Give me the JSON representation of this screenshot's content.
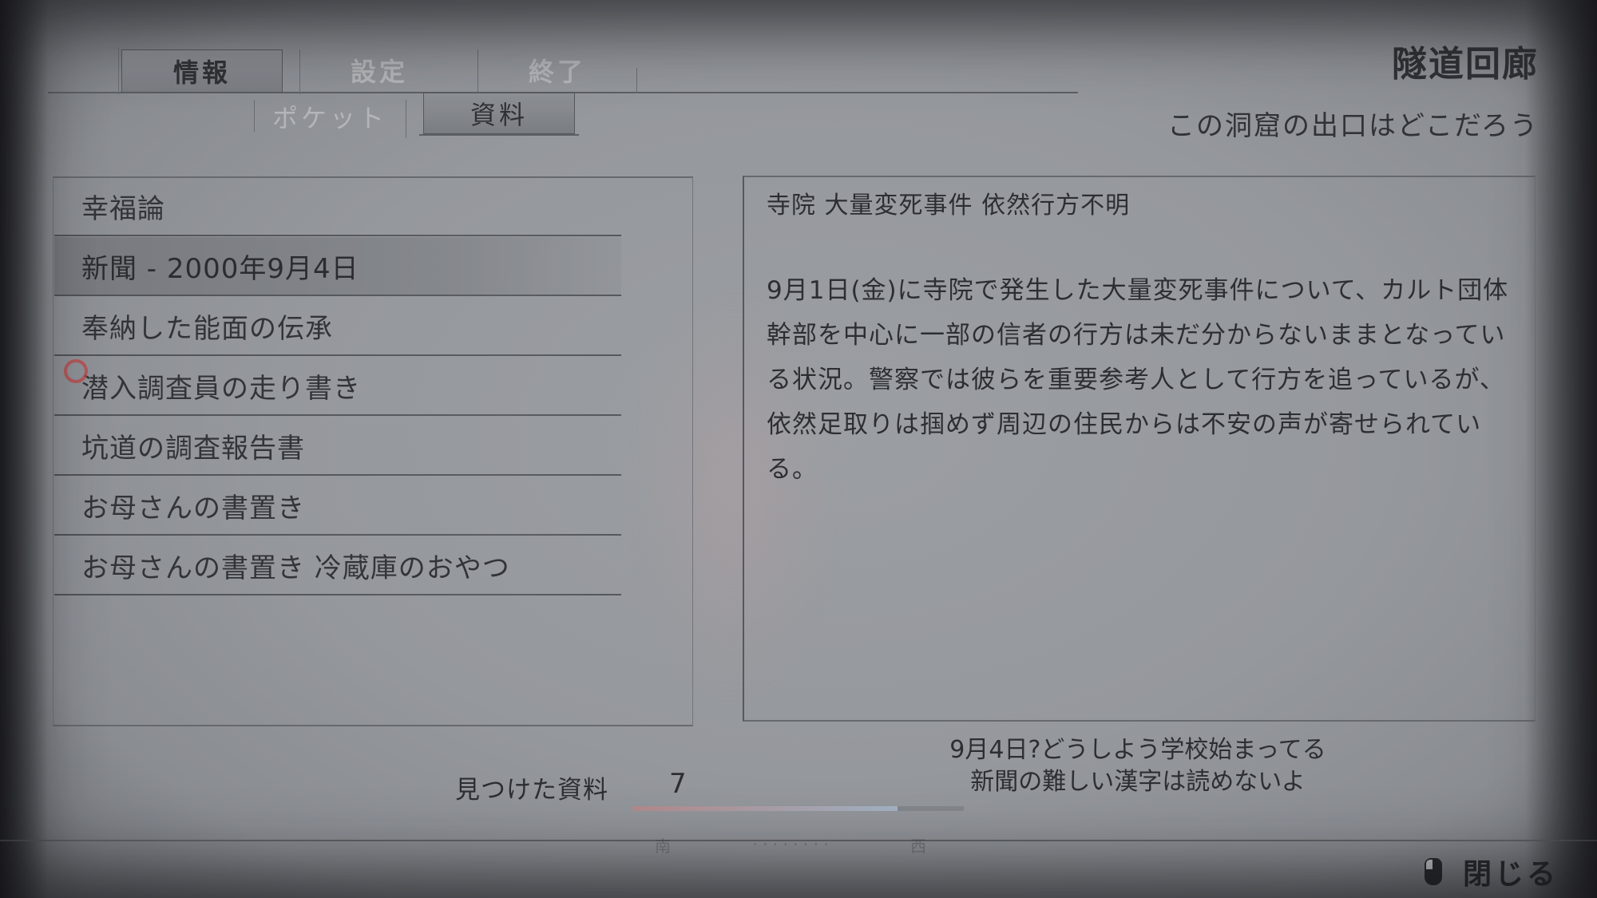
{
  "header": {
    "tabs": [
      {
        "label": "情報",
        "active": true
      },
      {
        "label": "設定",
        "active": false
      },
      {
        "label": "終了",
        "active": false
      }
    ],
    "subtabs": [
      {
        "label": "ポケット",
        "active": false
      },
      {
        "label": "資料",
        "active": true
      }
    ],
    "location_title": "隧道回廊",
    "objective": "この洞窟の出口はどこだろう"
  },
  "documents": {
    "items": [
      {
        "label": "幸福論",
        "selected": false
      },
      {
        "label": "新聞 - 2000年9月4日",
        "selected": true
      },
      {
        "label": "奉納した能面の伝承",
        "selected": false
      },
      {
        "label": "潜入調査員の走り書き",
        "selected": false
      },
      {
        "label": "坑道の調査報告書",
        "selected": false
      },
      {
        "label": "お母さんの書置き",
        "selected": false
      },
      {
        "label": "お母さんの書置き 冷蔵庫のおやつ",
        "selected": false
      }
    ],
    "found_label": "見つけた資料",
    "found_count": "7"
  },
  "document_view": {
    "headline": "寺院 大量変死事件 依然行方不明",
    "body": "9月1日(金)に寺院で発生した大量変死事件について、カルト団体幹部を中心に一部の信者の行方は未だ分からないままとなっている状況。警察では彼らを重要参考人として行方を追っているが、依然足取りは掴めず周辺の住民からは不安の声が寄せられている。"
  },
  "dialog": {
    "line1": "9月4日?どうしよう学校始まってる",
    "line2": "新聞の難しい漢字は読めないよ"
  },
  "compass": {
    "south": "南",
    "west": "西"
  },
  "footer": {
    "close_label": "閉じる",
    "close_icon": "mouse-icon"
  }
}
